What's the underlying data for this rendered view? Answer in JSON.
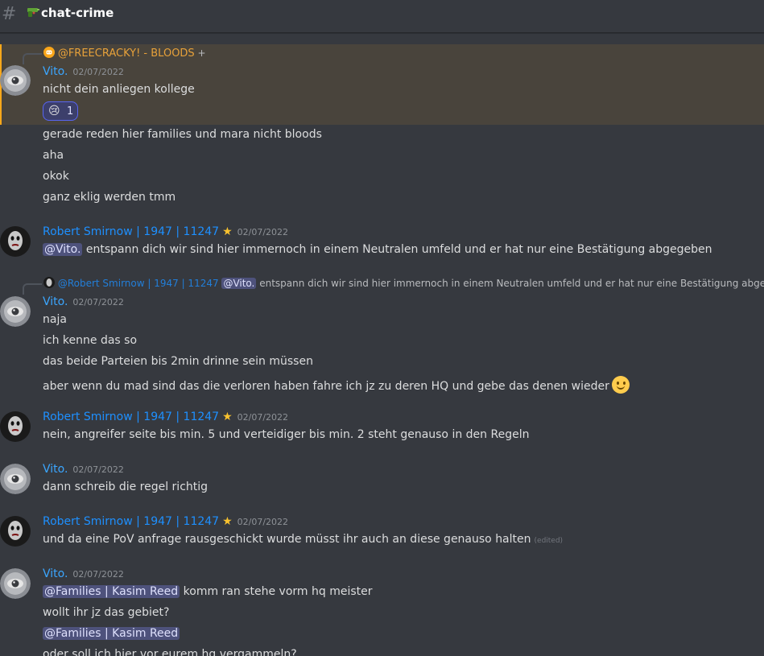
{
  "channel": {
    "hash_symbol": "#",
    "icon": "pistol-emoji-icon",
    "name": "chat-crime"
  },
  "colors": {
    "vito": "#3ba6ff",
    "robert": "#1e90ff",
    "mention_bg": "#4e527c",
    "highlight": "#49443c"
  },
  "messages": {
    "m1": {
      "reply_role": "@FREECRACKY! - BLOODS",
      "reply_plus": "+",
      "author": "Vito.",
      "time": "02/07/2022",
      "lines": [
        "nicht dein anliegen kollege"
      ],
      "reaction_emoji": "😢",
      "reaction_count": "1",
      "more": [
        "gerade reden hier families und mara nicht bloods",
        "aha",
        "okok",
        "ganz eklig werden tmm"
      ]
    },
    "m2": {
      "author": "Robert Smirnow | 1947 | 11247",
      "time": "02/07/2022",
      "mention": "@Vito.",
      "text": "entspann dich wir sind hier immernoch in einem Neutralen umfeld und er hat nur eine Bestätigung abgegeben"
    },
    "m3": {
      "reply_author": "@Robert Smirnow | 1947 | 11247",
      "reply_mention": "@Vito.",
      "reply_text": "entspann dich wir sind hier immernoch in einem Neutralen umfeld und er hat nur eine Bestätigung abgegeben",
      "author": "Vito.",
      "time": "02/07/2022",
      "lines": [
        "naja",
        "ich kenne das so",
        "das beide Parteien bis 2min drinne sein müssen",
        "aber wenn du mad sind das die verloren haben fahre ich jz zu deren HQ und gebe das denen wieder"
      ]
    },
    "m4": {
      "author": "Robert Smirnow | 1947 | 11247",
      "time": "02/07/2022",
      "text": "nein, angreifer seite bis min. 5 und verteidiger bis min. 2 steht genauso in den Regeln"
    },
    "m5": {
      "author": "Vito.",
      "time": "02/07/2022",
      "text": "dann schreib die regel richtig"
    },
    "m6": {
      "author": "Robert Smirnow | 1947 | 11247",
      "time": "02/07/2022",
      "text": "und da eine PoV anfrage rausgeschickt wurde müsst ihr auch an diese genauso halten",
      "edited": "(edited)"
    },
    "m7": {
      "author": "Vito.",
      "time": "02/07/2022",
      "mention": "@Families | Kasim Reed",
      "text": "komm ran stehe vorm hq meister",
      "line2": "wollt ihr jz das gebiet?",
      "line3_mention": "@Families | Kasim Reed",
      "line4": "oder soll ich hier vor eurem hq vergammeln?"
    }
  }
}
